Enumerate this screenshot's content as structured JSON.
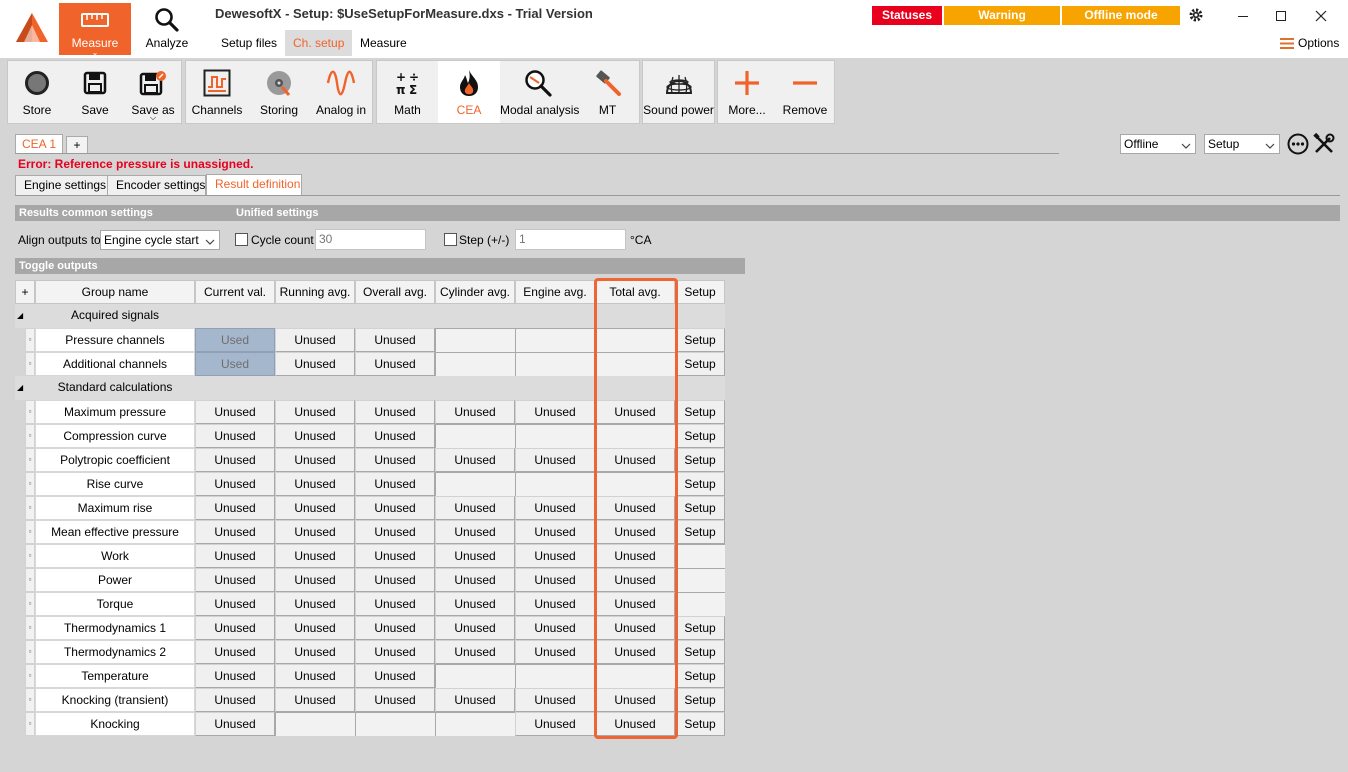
{
  "window": {
    "title": "DewesoftX - Setup: $UseSetupForMeasure.dxs - Trial Version",
    "statuses": "Statuses",
    "warning": "Warning",
    "offline_mode": "Offline mode",
    "options": "Options",
    "accent_color": "#f0632b"
  },
  "main_tabs": {
    "measure": "Measure",
    "analyze": "Analyze"
  },
  "sub_tabs": {
    "setup_files": "Setup files",
    "ch_setup": "Ch. setup",
    "measure": "Measure"
  },
  "toolbar": {
    "store": "Store",
    "save": "Save",
    "save_as": "Save as",
    "channels": "Channels",
    "storing": "Storing",
    "analog_in": "Analog in",
    "math": "Math",
    "cea": "CEA",
    "modal_analysis": "Modal analysis",
    "mt": "MT",
    "sound_power": "Sound power",
    "more": "More...",
    "remove": "Remove"
  },
  "cea": {
    "tab": "CEA 1",
    "add": "+",
    "error": "Error: Reference pressure is unassigned.",
    "mode": "Offline",
    "view": "Setup"
  },
  "inner_tabs": {
    "engine": "Engine settings",
    "encoder": "Encoder settings",
    "result": "Result definition"
  },
  "common": {
    "section": "Results common settings",
    "unified": "Unified settings",
    "align_label": "Align outputs to",
    "align_value": "Engine cycle start",
    "cycle_label": "Cycle count",
    "cycle_value": "30",
    "step_label": "Step (+/-)",
    "step_value": "1",
    "unit": "°CA"
  },
  "toggle": {
    "section": "Toggle outputs",
    "headers": [
      "+",
      "Group name",
      "Current val.",
      "Running avg.",
      "Overall avg.",
      "Cylinder avg.",
      "Engine avg.",
      "Total avg.",
      "Setup"
    ],
    "rows": [
      {
        "type": "group",
        "name": "Acquired signals"
      },
      {
        "type": "item",
        "name": "Pressure channels",
        "cells": [
          "Used",
          "Unused",
          "Unused",
          "",
          "",
          "",
          "Setup"
        ]
      },
      {
        "type": "item",
        "name": "Additional channels",
        "cells": [
          "Used",
          "Unused",
          "Unused",
          "",
          "",
          "",
          "Setup"
        ]
      },
      {
        "type": "group",
        "name": "Standard calculations"
      },
      {
        "type": "item",
        "name": "Maximum pressure",
        "cells": [
          "Unused",
          "Unused",
          "Unused",
          "Unused",
          "Unused",
          "Unused",
          "Setup"
        ]
      },
      {
        "type": "item",
        "name": "Compression curve",
        "cells": [
          "Unused",
          "Unused",
          "Unused",
          "",
          "",
          "",
          "Setup"
        ]
      },
      {
        "type": "item",
        "name": "Polytropic coefficient",
        "cells": [
          "Unused",
          "Unused",
          "Unused",
          "Unused",
          "Unused",
          "Unused",
          "Setup"
        ]
      },
      {
        "type": "item",
        "name": "Rise curve",
        "cells": [
          "Unused",
          "Unused",
          "Unused",
          "",
          "",
          "",
          "Setup"
        ]
      },
      {
        "type": "item",
        "name": "Maximum rise",
        "cells": [
          "Unused",
          "Unused",
          "Unused",
          "Unused",
          "Unused",
          "Unused",
          "Setup"
        ]
      },
      {
        "type": "item",
        "name": "Mean effective pressure",
        "cells": [
          "Unused",
          "Unused",
          "Unused",
          "Unused",
          "Unused",
          "Unused",
          "Setup"
        ]
      },
      {
        "type": "item",
        "name": "Work",
        "cells": [
          "Unused",
          "Unused",
          "Unused",
          "Unused",
          "Unused",
          "Unused",
          ""
        ]
      },
      {
        "type": "item",
        "name": "Power",
        "cells": [
          "Unused",
          "Unused",
          "Unused",
          "Unused",
          "Unused",
          "Unused",
          ""
        ]
      },
      {
        "type": "item",
        "name": "Torque",
        "cells": [
          "Unused",
          "Unused",
          "Unused",
          "Unused",
          "Unused",
          "Unused",
          ""
        ]
      },
      {
        "type": "item",
        "name": "Thermodynamics 1",
        "cells": [
          "Unused",
          "Unused",
          "Unused",
          "Unused",
          "Unused",
          "Unused",
          "Setup"
        ]
      },
      {
        "type": "item",
        "name": "Thermodynamics 2",
        "cells": [
          "Unused",
          "Unused",
          "Unused",
          "Unused",
          "Unused",
          "Unused",
          "Setup"
        ]
      },
      {
        "type": "item",
        "name": "Temperature",
        "cells": [
          "Unused",
          "Unused",
          "Unused",
          "",
          "",
          "",
          "Setup"
        ]
      },
      {
        "type": "item",
        "name": "Knocking (transient)",
        "cells": [
          "Unused",
          "Unused",
          "Unused",
          "Unused",
          "Unused",
          "Unused",
          "Setup"
        ]
      },
      {
        "type": "item",
        "name": "Knocking",
        "cells": [
          "Unused",
          "",
          "",
          "",
          "Unused",
          "Unused",
          "Setup"
        ]
      }
    ]
  }
}
